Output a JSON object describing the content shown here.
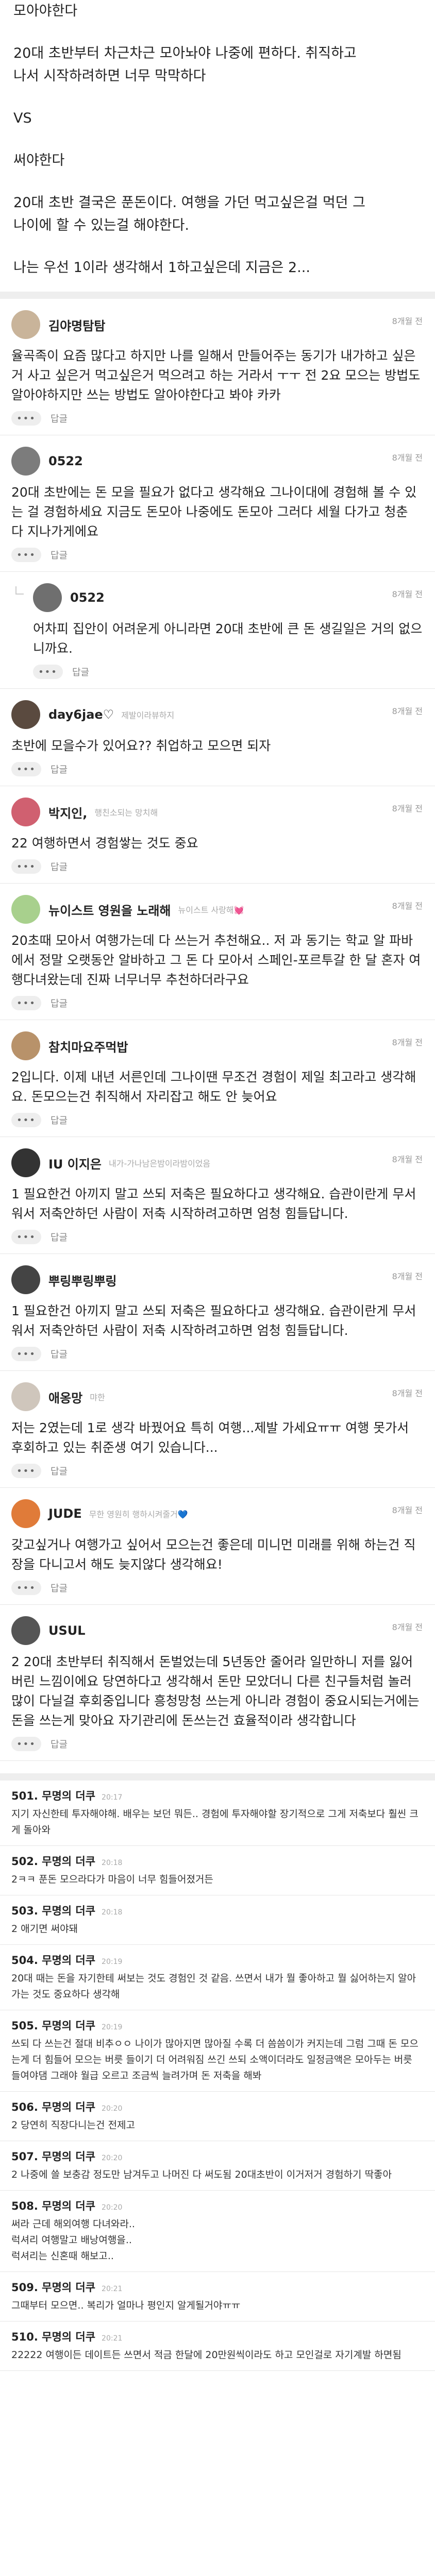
{
  "post": {
    "lines": [
      "모아야한다",
      "",
      "20대 초반부터 차근차근 모아놔야 나중에 편하다. 취직하고",
      "나서 시작하려하면 너무 막막하다",
      "",
      "VS",
      "",
      "써야한다",
      "",
      "20대 초반 결국은 푼돈이다. 여행을 가던 먹고싶은걸 먹던 그",
      "나이에 할 수 있는걸 해야한다.",
      "",
      "나는 우선 1이라 생각해서 1하고싶은데 지금은 2..."
    ]
  },
  "ui": {
    "more": "•••",
    "reply": "답글"
  },
  "comments": [
    {
      "name": "김야명탐탐",
      "sub": "",
      "time": "8개월 전",
      "reply": false,
      "avatar_color": "#c9b49a",
      "text": "율곡족이 요즘 많다고 하지만 나를 일해서 만들어주는 동기가 내가하고 싶은거 사고 싶은거 먹고싶은거 먹으려고 하는 거라서 ㅜㅜ 전 2요 모으는 방법도 알아야하지만 쓰는 방법도 알아야한다고 봐야 카카"
    },
    {
      "name": "0522",
      "sub": "",
      "time": "8개월 전",
      "reply": false,
      "avatar_color": "#7c7c7c",
      "text": "20대 초반에는 돈 모을 필요가 없다고 생각해요 그나이대에 경험해 볼 수 있는 걸 경험하세요 지금도 돈모아 나중에도 돈모아 그러다 세월 다가고 청춘 다 지나가게에요"
    },
    {
      "name": "0522",
      "sub": "",
      "time": "8개월 전",
      "reply": true,
      "avatar_color": "#6f6f6f",
      "text": "어차피 집안이 어려운게 아니라면 20대 초반에 큰 돈 생길일은 거의 없으니까요."
    },
    {
      "name": "day6jae♡",
      "sub": "제발이라뷰하지",
      "time": "8개월 전",
      "reply": false,
      "avatar_color": "#5a4a3f",
      "text": "초반에 모을수가 있어요?? 취업하고 모으면 되자"
    },
    {
      "name": "박지인,",
      "sub": "행친소되는 망치해",
      "time": "8개월 전",
      "reply": false,
      "avatar_color": "#d06070",
      "text": "22 여행하면서 경험쌓는 것도 중요"
    },
    {
      "name": "뉴이스트 영원을 노래해",
      "sub": "뉴이스트 사랑해💓",
      "time": "8개월 전",
      "reply": false,
      "avatar_color": "#a8d08d",
      "text": "20초때 모아서 여행가는데 다 쓰는거 추천해요.. 저 과 동기는 학교 알 파바에서 정말 오랫동안 알바하고 그 돈 다 모아서 스페인-포르투갈 한 달 혼자 여행다녀왔는데 진짜 너무너무 추천하더라구요"
    },
    {
      "name": "참치마요주먹밥",
      "sub": "",
      "time": "8개월 전",
      "reply": false,
      "avatar_color": "#b8926a",
      "text": "2입니다. 이제 내년 서른인데 그나이땐 무조건 경험이 제일 최고라고 생각해요. 돈모으는건 취직해서 자리잡고 해도 안 늦어요"
    },
    {
      "name": "IU 이지은",
      "sub": "내가-가나남은밤이라밤이었음",
      "time": "8개월 전",
      "reply": false,
      "avatar_color": "#333333",
      "text": "1 필요한건 아끼지 말고 쓰되 저축은 필요하다고 생각해요. 습관이란게 무서워서 저축안하던 사람이 저축 시작하려고하면 엄청 힘들답니다."
    },
    {
      "name": "뿌링뿌링뿌링",
      "sub": "",
      "time": "8개월 전",
      "reply": false,
      "avatar_color": "#444444",
      "text": "1 필요한건 아끼지 말고 쓰되 저축은 필요하다고 생각해요. 습관이란게 무서워서 저축안하던 사람이 저축 시작하려고하면 엄청 힘들답니다."
    },
    {
      "name": "애옹망",
      "sub": "먀한",
      "time": "8개월 전",
      "reply": false,
      "avatar_color": "#cfc6bc",
      "text": "저는 2였는데 1로 생각 바꿨어요 특히 여행...제발 가세요ㅠㅠ 여행 못가서 후회하고 있는 취준생 여기 있습니다..."
    },
    {
      "name": "JUDE",
      "sub": "무한 영원히 행하시켜줄거💙",
      "time": "8개월 전",
      "reply": false,
      "avatar_color": "#e07b39",
      "text": "갖고싶거나 여행가고 싶어서 모으는건 좋은데 미니먼 미래를 위해 하는건 직장을 다니고서 해도 늦지않다 생각해요!"
    },
    {
      "name": "USUL",
      "sub": "",
      "time": "8개월 전",
      "reply": false,
      "avatar_color": "#555555",
      "text": "2 20대 초반부터 취직해서 돈벌었는데 5년동안 줄어라 일만하니 저를 잃어버린 느낌이에요 당연하다고 생각해서 돈만 모았더니 다른 친구들처럼 놀러 많이 다닐걸 후회중입니다 흥청망청 쓰는게 아니라 경험이 중요시되는거에는 돈을 쓰는게 맞아요 자기관리에 돈쓰는건 효율적이라 생각합니다"
    }
  ],
  "board": [
    {
      "name": "501. 무명의 더쿠",
      "time": "20:17",
      "text": "지기 자신한테 투자해야해. 배우는 보던 뭐든.. 경험에 투자해야할 장기적으로 그게 저축보다 훨씬 크게 돌아와"
    },
    {
      "name": "502. 무명의 더쿠",
      "time": "20:18",
      "text": "2ㅋㅋ 푼돈 모으라다가 마음이 너무 힘들어졌거든"
    },
    {
      "name": "503. 무명의 더쿠",
      "time": "20:18",
      "text": "2 애기면 써야돼"
    },
    {
      "name": "504. 무명의 더쿠",
      "time": "20:19",
      "text": "20대 때는 돈을 자기한테 써보는 것도 경험인 것 같음. 쓰면서 내가 뭘 좋아하고 뭘 싫어하는지 알아가는 것도 중요하다 생각해"
    },
    {
      "name": "505. 무명의 더쿠",
      "time": "20:19",
      "text": "쓰되 다 쓰는건 절대 비추ㅇㅇ 나이가 많아지면 많아질 수록 더 씀씀이가 커지는데 그럼 그때 돈 모으는게 더 힘들어 모으는 버릇 들이기 더 어려워짐 쓰긴 쓰되 소액이더라도 일정금액은 모아두는 버릇 들여야댐 그래야 월급 오르고 조금씩 늘려가며 돈 저축을 해봐"
    },
    {
      "name": "506. 무명의 더쿠",
      "time": "20:20",
      "text": "2 당연히 직장다니는건 전제고"
    },
    {
      "name": "507. 무명의 더쿠",
      "time": "20:20",
      "text": "2 나중에 쓸 보충감 정도만 남겨두고 나머진 다 써도됨 20대초반이 이거저거 경험하기 딱좋아"
    },
    {
      "name": "508. 무명의 더쿠",
      "time": "20:20",
      "text": "써라 근데 해외여행 다녀와라..\n럭셔리 여행말고 배낭여행을..\n럭셔리는 신혼때 해보고.."
    },
    {
      "name": "509. 무명의 더쿠",
      "time": "20:21",
      "text": "그때부터 모으면.. 복리가 얼마나 평인지 알게될거야ㅠㅠ"
    },
    {
      "name": "510. 무명의 더쿠",
      "time": "20:21",
      "text": "22222 여행이든 데이트든 쓰면서 적금 한달에 20만원씩이라도 하고 모인걸로 자기계발 하면됨"
    }
  ]
}
